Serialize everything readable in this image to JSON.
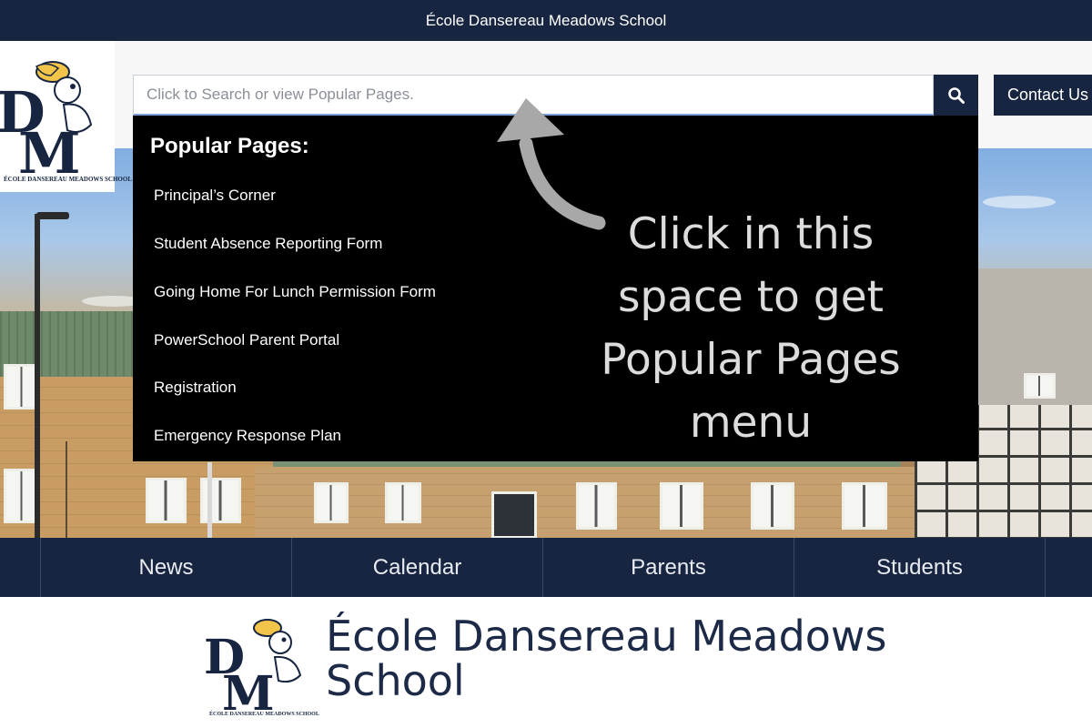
{
  "topbar": {
    "title": "École Dansereau Meadows School"
  },
  "logo": {
    "letters": "DM",
    "caption": "ÉCOLE DANSEREAU MEADOWS SCHOOL"
  },
  "search": {
    "placeholder": "Click to Search or view Popular Pages.",
    "button_icon": "search-icon"
  },
  "header": {
    "contact_label": "Contact Us"
  },
  "dropdown": {
    "heading": "Popular Pages:",
    "items": [
      "Principal’s Corner",
      "Student Absence Reporting Form",
      "Going Home For Lunch Permission Form",
      "PowerSchool Parent Portal",
      "Registration",
      "Emergency Response Plan"
    ]
  },
  "annotation": {
    "lines": [
      "Click in this",
      "space to get",
      "Popular Pages",
      "menu"
    ],
    "arrow_icon": "curved-arrow-icon"
  },
  "nav": {
    "items": [
      "News",
      "Calendar",
      "Parents",
      "Students"
    ]
  },
  "brand": {
    "line1": "École Dansereau Meadows",
    "line2": "School"
  },
  "colors": {
    "navy": "#172540",
    "dropdown_bg": "#000000",
    "annotation_text": "#dcdcdc"
  }
}
